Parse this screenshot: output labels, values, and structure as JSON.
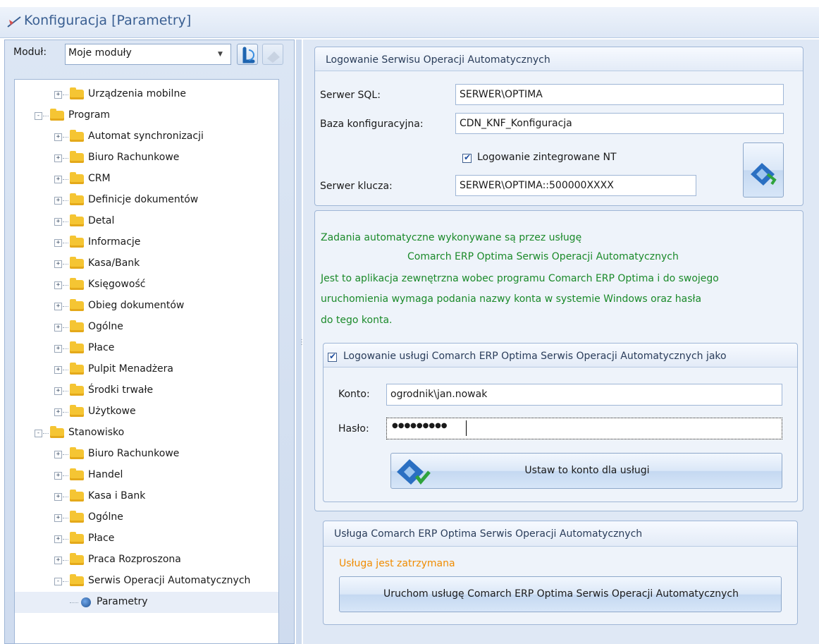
{
  "window": {
    "title": "Konfiguracja [Parametry]"
  },
  "left": {
    "modul_label": "Moduł:",
    "modul_value": "Moje moduły",
    "tree": [
      {
        "label": "Urządzenia mobilne",
        "level": 1,
        "expander": "+"
      },
      {
        "label": "Program",
        "level": 0,
        "expander": "−"
      },
      {
        "label": "Automat synchronizacji",
        "level": 1,
        "expander": "+"
      },
      {
        "label": "Biuro Rachunkowe",
        "level": 1,
        "expander": "+"
      },
      {
        "label": "CRM",
        "level": 1,
        "expander": "+"
      },
      {
        "label": "Definicje dokumentów",
        "level": 1,
        "expander": "+"
      },
      {
        "label": "Detal",
        "level": 1,
        "expander": "+"
      },
      {
        "label": "Informacje",
        "level": 1,
        "expander": "+"
      },
      {
        "label": "Kasa/Bank",
        "level": 1,
        "expander": "+"
      },
      {
        "label": "Księgowość",
        "level": 1,
        "expander": "+"
      },
      {
        "label": "Obieg dokumentów",
        "level": 1,
        "expander": "+"
      },
      {
        "label": "Ogólne",
        "level": 1,
        "expander": "+"
      },
      {
        "label": "Płace",
        "level": 1,
        "expander": "+"
      },
      {
        "label": "Pulpit Menadżera",
        "level": 1,
        "expander": "+"
      },
      {
        "label": "Środki trwałe",
        "level": 1,
        "expander": "+"
      },
      {
        "label": "Użytkowe",
        "level": 1,
        "expander": "+"
      },
      {
        "label": "Stanowisko",
        "level": 0,
        "expander": "−"
      },
      {
        "label": "Biuro Rachunkowe",
        "level": 1,
        "expander": "+"
      },
      {
        "label": "Handel",
        "level": 1,
        "expander": "+"
      },
      {
        "label": "Kasa i Bank",
        "level": 1,
        "expander": "+"
      },
      {
        "label": "Ogólne",
        "level": 1,
        "expander": "+"
      },
      {
        "label": "Płace",
        "level": 1,
        "expander": "+"
      },
      {
        "label": "Praca Rozproszona",
        "level": 1,
        "expander": "+"
      },
      {
        "label": "Serwis Operacji Automatycznych",
        "level": 1,
        "expander": "−"
      },
      {
        "label": "Parametry",
        "level": 2,
        "expander": "",
        "selected": true
      }
    ]
  },
  "login_group": {
    "title": "Logowanie Serwisu Operacji Automatycznych",
    "sql_label": "Serwer SQL:",
    "sql_value": "SERWER\\OPTIMA",
    "base_label": "Baza konfiguracyjna:",
    "base_value": "CDN_KNF_Konfiguracja",
    "nt_label": "Logowanie zintegrowane NT",
    "key_label": "Serwer klucza:",
    "key_value": "SERWER\\OPTIMA::500000XXXX"
  },
  "service_info": {
    "line1": "Zadania automatyczne wykonywane są przez usługę",
    "line2": "Comarch ERP Optima Serwis Operacji Automatycznych",
    "line3": "Jest to aplikacja zewnętrzna wobec programu Comarch ERP Optima i do swojego",
    "line4": "uruchomienia wymaga podania nazwy konta w systemie Windows oraz hasła",
    "line5": "do tego konta."
  },
  "account_group": {
    "title": "Logowanie usługi Comarch ERP Optima Serwis Operacji Automatycznych jako",
    "account_label": "Konto:",
    "account_value": "ogrodnik\\jan.nowak",
    "password_label": "Hasło:",
    "password_value": "●●●●●●●●●",
    "set_button": "Ustaw to konto dla usługi"
  },
  "status_group": {
    "title": "Usługa  Comarch ERP Optima Serwis Operacji Automatycznych",
    "status": "Usługa jest zatrzymana",
    "start_button": "Uruchom usługę Comarch ERP Optima Serwis Operacji Automatycznych"
  },
  "colors": {
    "info_text": "#1b8a2a",
    "status_text": "#f08c00",
    "title_text": "#3a5f92"
  },
  "icons": [
    "config-icon",
    "refresh-icon",
    "save-icon",
    "folder-icon",
    "gear-icon"
  ]
}
